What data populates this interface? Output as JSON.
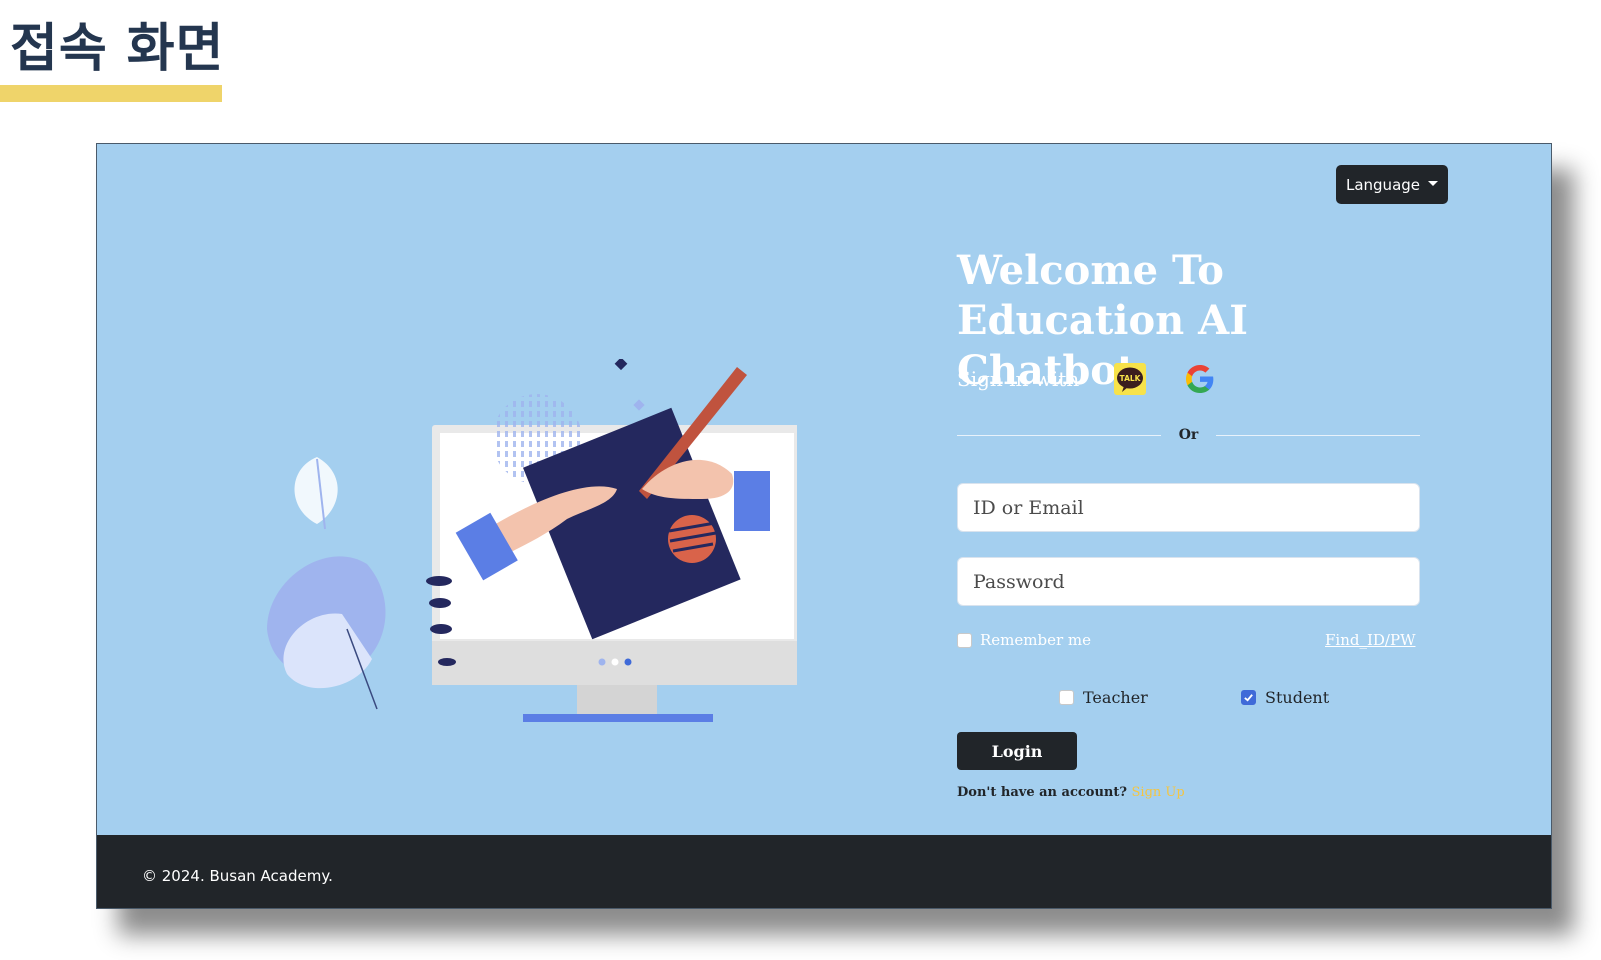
{
  "slide": {
    "title": "접속 화면",
    "accent_color": "#efd46a"
  },
  "app": {
    "hero_background": "#a4cfef",
    "language_button": "Language",
    "heading": "Welcome To Education AI Chatbot",
    "signin_label": "Sign in with",
    "kakao_icon_text": "TALK",
    "or_label": "Or",
    "id_placeholder": "ID or Email",
    "password_placeholder": "Password",
    "remember_label": "Remember me",
    "remember_checked": false,
    "find_link": "Find_ID/PW",
    "roles": [
      {
        "label": "Teacher",
        "checked": false
      },
      {
        "label": "Student",
        "checked": true
      }
    ],
    "login_button": "Login",
    "signup_prompt": "Don't have an account?",
    "signup_link": "Sign Up",
    "footer_text": "© 2024. Busan Academy."
  }
}
